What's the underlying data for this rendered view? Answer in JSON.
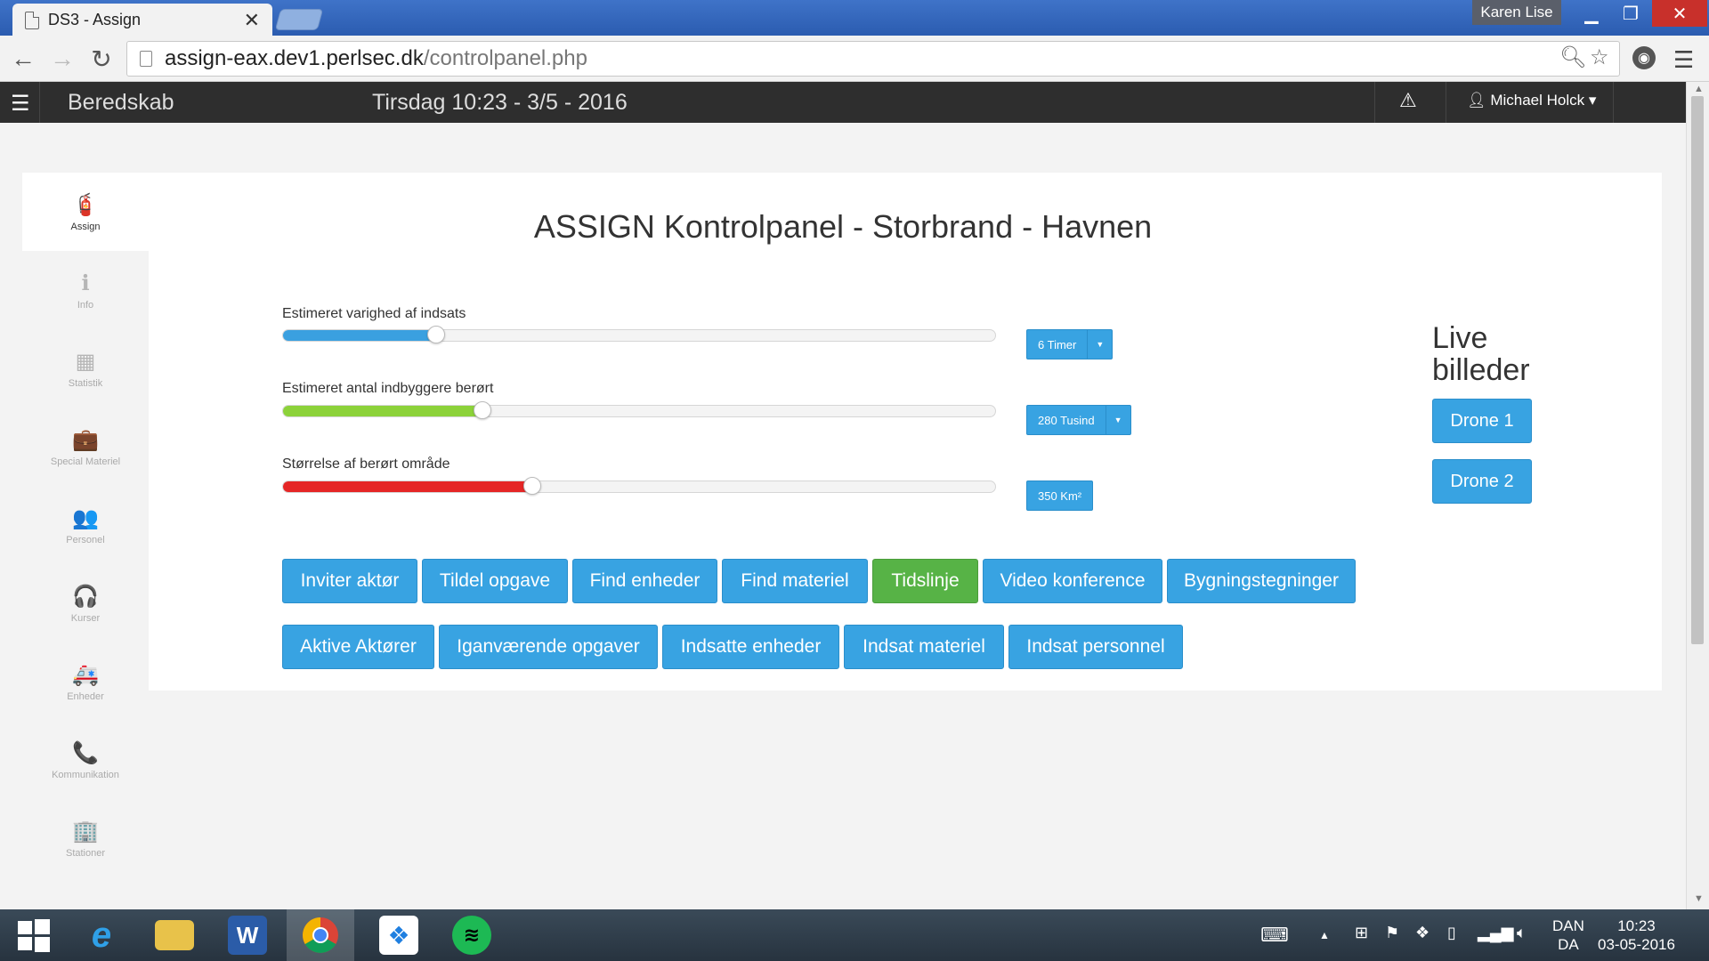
{
  "browser": {
    "tab_title": "DS3 - Assign",
    "tab_close": "✕",
    "profile_name": "Karen Lise",
    "url_host": "assign-eax.dev1.perlsec.dk",
    "url_path": "/controlpanel.php"
  },
  "appbar": {
    "brand": "Beredskab",
    "datetime": "Tirsdag 10:23 - 3/5 - 2016",
    "user": "Michael Holck"
  },
  "sidebar": {
    "items": [
      {
        "label": "Assign",
        "icon": "fire-extinguisher-icon",
        "glyph": "🧯"
      },
      {
        "label": "Info",
        "icon": "info-icon",
        "glyph": "ℹ"
      },
      {
        "label": "Statistik",
        "icon": "calendar-icon",
        "glyph": "▦"
      },
      {
        "label": "Special Materiel",
        "icon": "briefcase-icon",
        "glyph": "💼"
      },
      {
        "label": "Personel",
        "icon": "people-icon",
        "glyph": "👥"
      },
      {
        "label": "Kurser",
        "icon": "headphones-icon",
        "glyph": "🎧"
      },
      {
        "label": "Enheder",
        "icon": "ambulance-icon",
        "glyph": "🚑"
      },
      {
        "label": "Kommunikation",
        "icon": "phone-icon",
        "glyph": "📞"
      },
      {
        "label": "Stationer",
        "icon": "building-icon",
        "glyph": "🏢"
      }
    ]
  },
  "main": {
    "title": "ASSIGN Kontrolpanel - Storbrand - Havnen",
    "sliders": [
      {
        "label": "Estimeret varighed af indsats",
        "value": 0.215,
        "color": "#3aa0e0",
        "button": "6 Timer",
        "has_caret": true
      },
      {
        "label": "Estimeret antal indbyggere berørt",
        "value": 0.28,
        "color": "#8cd23a",
        "button": "280 Tusind",
        "has_caret": true
      },
      {
        "label": "Størrelse af berørt område",
        "value": 0.35,
        "color": "#e52626",
        "button": "350 Km²",
        "has_caret": false
      }
    ],
    "live_title_line1": "Live",
    "live_title_line2": "billeder",
    "drone_buttons": [
      "Drone 1",
      "Drone 2"
    ],
    "action_row1": [
      "Inviter aktør",
      "Tildel opgave",
      "Find enheder",
      "Find materiel",
      "Tidslinje",
      "Video konference",
      "Bygningstegninger"
    ],
    "action_row2": [
      "Aktive Aktører",
      "Iganværende opgaver",
      "Indsatte enheder",
      "Indsat materiel",
      "Indsat personnel"
    ]
  },
  "taskbar": {
    "apps": [
      "start",
      "internet-explorer",
      "file-explorer",
      "word",
      "chrome",
      "dropbox",
      "spotify"
    ],
    "lang_top": "DAN",
    "lang_bottom": "DA",
    "time": "10:23",
    "date": "03-05-2016"
  },
  "colors": {
    "accent": "#38a3e2",
    "active_green": "#57b346",
    "appbar": "#2e2e2e"
  }
}
